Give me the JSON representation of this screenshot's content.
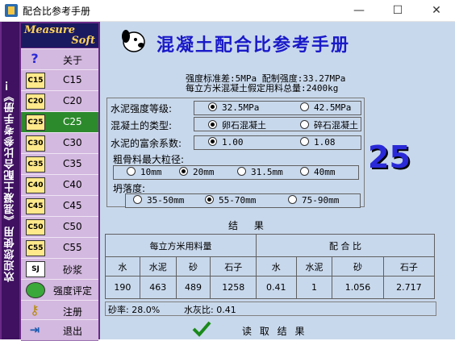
{
  "window": {
    "title": "配合比参考手册",
    "min": "—",
    "max": "☐",
    "close": "✕"
  },
  "sidebar": {
    "vertical_text": "欢迎您使用《混凝土配合比参考手册》！",
    "logo_line1": "Measure",
    "logo_line2": "Soft",
    "items": [
      {
        "icon": "?",
        "label": "关于"
      },
      {
        "icon": "C15",
        "label": "C15"
      },
      {
        "icon": "C20",
        "label": "C20"
      },
      {
        "icon": "C25",
        "label": "C25"
      },
      {
        "icon": "C30",
        "label": "C30"
      },
      {
        "icon": "C35",
        "label": "C35"
      },
      {
        "icon": "C40",
        "label": "C40"
      },
      {
        "icon": "C45",
        "label": "C45"
      },
      {
        "icon": "C50",
        "label": "C50"
      },
      {
        "icon": "C55",
        "label": "C55"
      },
      {
        "icon": "SJ",
        "label": "砂浆"
      },
      {
        "icon": "pie",
        "label": "强度评定"
      },
      {
        "icon": "key",
        "label": "注册"
      },
      {
        "icon": "exit",
        "label": "退出"
      }
    ]
  },
  "header": {
    "title": "混凝土配合比参考手册"
  },
  "info": {
    "line1": "强度标准差:5MPa 配制强度:33.27MPa",
    "line2": "每立方米混凝土假定用料总量:2400kg"
  },
  "options": {
    "cement_label": "水泥强度等级:",
    "cement_opts": [
      "32.5MPa",
      "42.5MPa"
    ],
    "type_label": "混凝土的类型:",
    "type_opts": [
      "卵石混凝土",
      "碎石混凝土"
    ],
    "rich_label": "水泥的富余系数:",
    "rich_opts": [
      "1.00",
      "1.08"
    ],
    "agg_label": "粗骨料最大粒径:",
    "agg_opts": [
      "10mm",
      "20mm",
      "31.5mm",
      "40mm"
    ],
    "slump_label": "坍落度:",
    "slump_opts": [
      "35-50mm",
      "55-70mm",
      "75-90mm"
    ]
  },
  "grade_display": "25",
  "result": {
    "title": "结 果",
    "usage_header": "每立方米用料量",
    "ratio_header": "配 合 比",
    "cols": [
      "水",
      "水泥",
      "砂",
      "石子",
      "水",
      "水泥",
      "砂",
      "石子"
    ],
    "values": [
      "190",
      "463",
      "489",
      "1258",
      "0.41",
      "1",
      "1.056",
      "2.717"
    ]
  },
  "bottom": {
    "sand_rate": "砂率: 28.0%",
    "wc_ratio": "水灰比: 0.41"
  },
  "read_button": "读 取 结 果"
}
